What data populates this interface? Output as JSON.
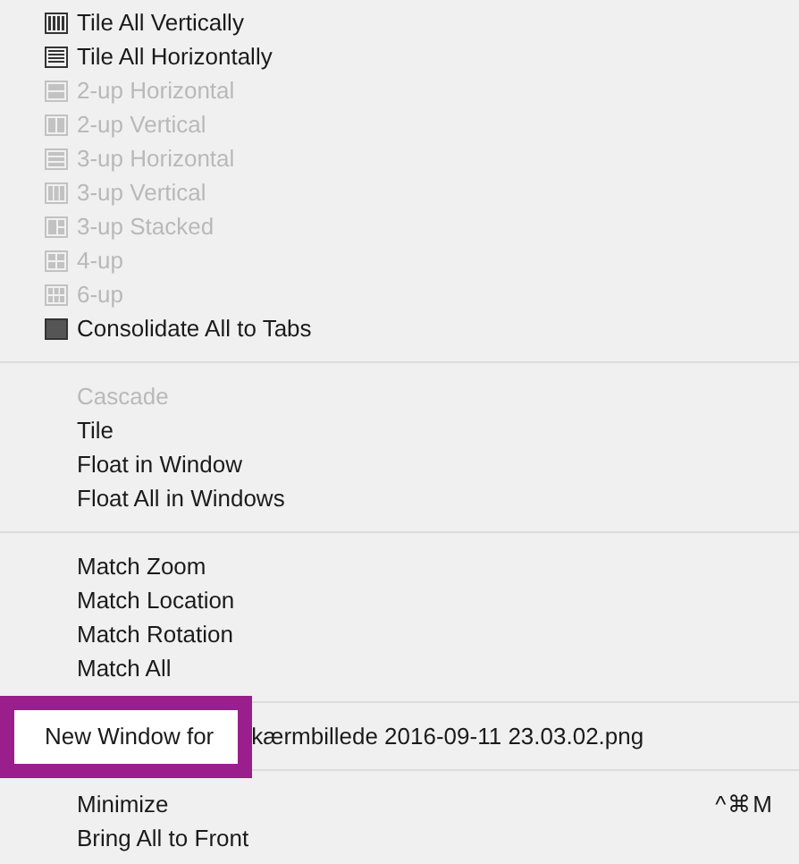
{
  "menu": {
    "groups": [
      {
        "items": [
          {
            "label": "Tile All Vertically",
            "disabled": false
          },
          {
            "label": "Tile All Horizontally",
            "disabled": false
          },
          {
            "label": "2-up Horizontal",
            "disabled": true
          },
          {
            "label": "2-up Vertical",
            "disabled": true
          },
          {
            "label": "3-up Horizontal",
            "disabled": true
          },
          {
            "label": "3-up Vertical",
            "disabled": true
          },
          {
            "label": "3-up Stacked",
            "disabled": true
          },
          {
            "label": "4-up",
            "disabled": true
          },
          {
            "label": "6-up",
            "disabled": true
          },
          {
            "label": "Consolidate All to Tabs",
            "disabled": false
          }
        ]
      },
      {
        "items": [
          {
            "label": "Cascade",
            "disabled": true
          },
          {
            "label": "Tile",
            "disabled": false
          },
          {
            "label": "Float in Window",
            "disabled": false
          },
          {
            "label": "Float All in Windows",
            "disabled": false
          }
        ]
      },
      {
        "items": [
          {
            "label": "Match Zoom",
            "disabled": false
          },
          {
            "label": "Match Location",
            "disabled": false
          },
          {
            "label": "Match Rotation",
            "disabled": false
          },
          {
            "label": "Match All",
            "disabled": false
          }
        ]
      },
      {
        "items": [
          {
            "label": "New Window for",
            "file_name": "kærmbillede 2016-09-11 23.03.02.png",
            "highlighted": true,
            "disabled": false
          }
        ]
      },
      {
        "items": [
          {
            "label": "Minimize",
            "shortcut": "^⌘M",
            "disabled": false
          },
          {
            "label": "Bring All to Front",
            "disabled": false
          }
        ]
      }
    ]
  }
}
